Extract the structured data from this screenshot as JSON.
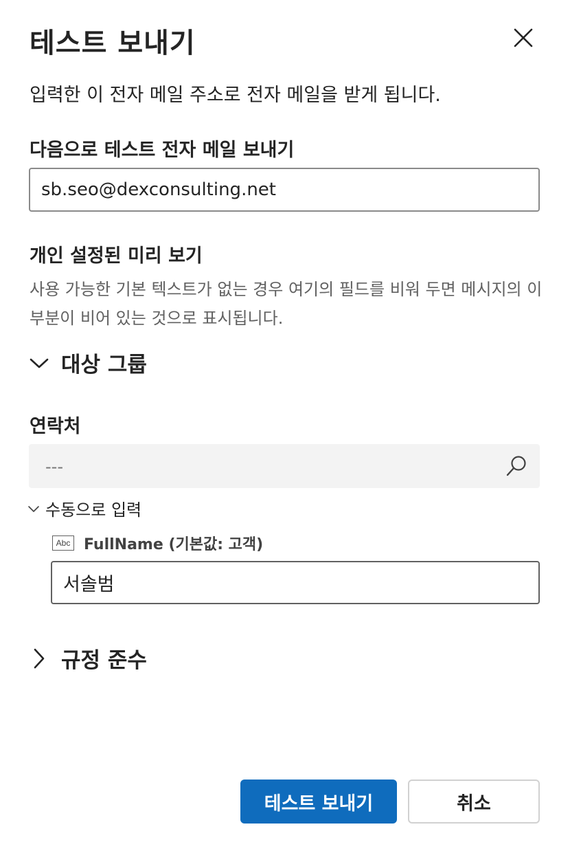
{
  "dialog": {
    "title": "테스트 보내기",
    "description": "입력한 이 전자 메일 주소로 전자 메일을 받게 됩니다."
  },
  "email": {
    "label": "다음으로 테스트 전자 메일 보내기",
    "value": "sb.seo@dexconsulting.net"
  },
  "preview": {
    "label": "개인 설정된 미리 보기",
    "help": "사용 가능한 기본 텍스트가 없는 경우 여기의 필드를 비워 두면 메시지의 이 부분이 비어 있는 것으로 표시됩니다."
  },
  "audience": {
    "title": "대상 그룹",
    "expanded": true,
    "contact_label": "연락처",
    "contact_placeholder": "---",
    "manual_label": "수동으로 입력",
    "field_name": "FullName (기본값: 고객)",
    "field_value": "서솔범",
    "field_icon": "Abc"
  },
  "compliance": {
    "title": "규정 준수",
    "expanded": false
  },
  "buttons": {
    "send": "테스트 보내기",
    "cancel": "취소"
  },
  "colors": {
    "primary": "#0f6cbd",
    "text": "#242424",
    "muted": "#616161"
  }
}
